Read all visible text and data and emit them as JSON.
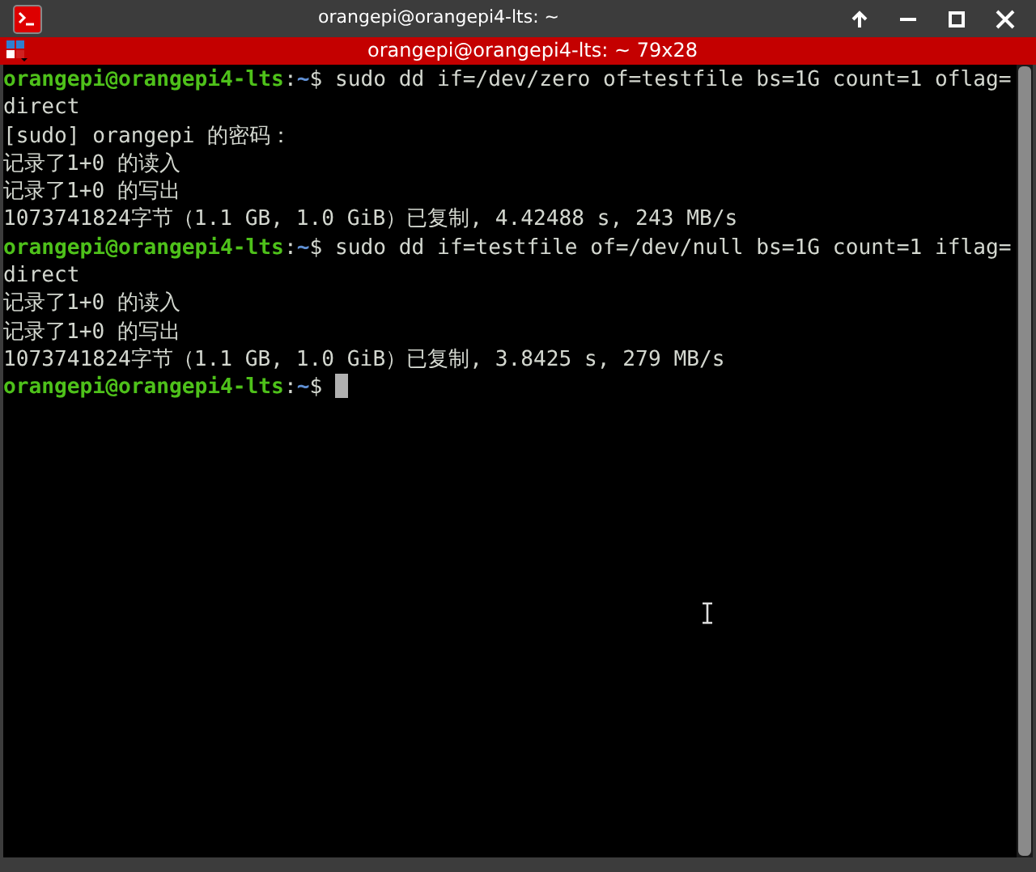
{
  "window": {
    "title": "orangepi@orangepi4-lts: ~"
  },
  "tab_bar": {
    "title": "orangepi@orangepi4-lts: ~ 79x28"
  },
  "terminal": {
    "lines": [
      {
        "kind": "prompt",
        "user": "orangepi@orangepi4-lts",
        "separator": ":",
        "path": "~",
        "sign": "$",
        "command": " sudo dd if=/dev/zero of=testfile bs=1G count=1 oflag=",
        "cursor": false
      },
      {
        "kind": "output",
        "text": "direct"
      },
      {
        "kind": "output",
        "text": "[sudo] orangepi 的密码："
      },
      {
        "kind": "output",
        "text": "记录了1+0 的读入"
      },
      {
        "kind": "output",
        "text": "记录了1+0 的写出"
      },
      {
        "kind": "output",
        "text": "1073741824字节（1.1 GB, 1.0 GiB）已复制, 4.42488 s, 243 MB/s"
      },
      {
        "kind": "prompt",
        "user": "orangepi@orangepi4-lts",
        "separator": ":",
        "path": "~",
        "sign": "$",
        "command": " sudo dd if=testfile of=/dev/null bs=1G count=1 iflag=",
        "cursor": false
      },
      {
        "kind": "output",
        "text": "direct"
      },
      {
        "kind": "output",
        "text": "记录了1+0 的读入"
      },
      {
        "kind": "output",
        "text": "记录了1+0 的写出"
      },
      {
        "kind": "output",
        "text": "1073741824字节（1.1 GB, 1.0 GiB）已复制, 3.8425 s, 279 MB/s"
      },
      {
        "kind": "prompt",
        "user": "orangepi@orangepi4-lts",
        "separator": ":",
        "path": "~",
        "sign": "$",
        "cursor": true
      }
    ]
  }
}
